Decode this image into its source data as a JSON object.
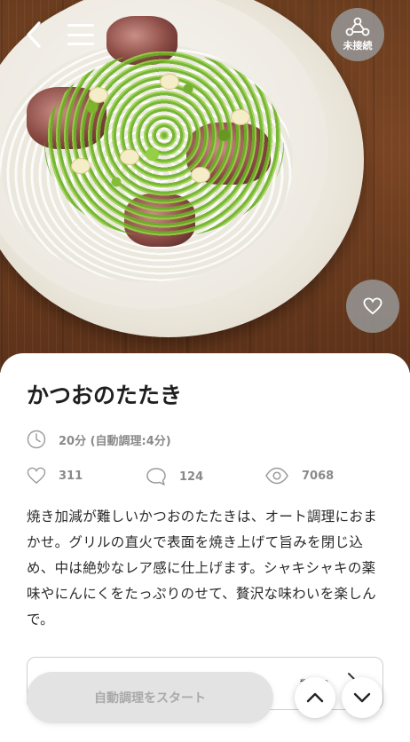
{
  "header": {
    "back_icon": "chevron-left-icon",
    "menu_icon": "hamburger-menu-icon",
    "connection_status": "未接続",
    "connection_icon": "network-nodes-icon",
    "favorite_icon": "heart-icon"
  },
  "recipe": {
    "title": "かつおのたたき",
    "time": "20分 (自動調理:4分)",
    "likes": "311",
    "comments": "124",
    "views": "7068",
    "description": "焼き加減が難しいかつおのたたきは、オート調理におまかせ。グリルの直火で表面を焼き上げて旨みを閉じ込め、中は絶妙なレア感に仕上げます。シャキシャキの薬味やにんにくをたっぷりのせて、贅沢な味わいを楽しんで。"
  },
  "servings": {
    "label_partial": "数 12"
  },
  "actions": {
    "start_label": "自動調理をスタート",
    "scroll_up_icon": "chevron-up-icon",
    "scroll_down_icon": "chevron-down-icon"
  },
  "colors": {
    "badge_bg": "#969696",
    "muted_text": "#8a8a8a",
    "button_disabled_bg": "#e3e3e3",
    "button_disabled_text": "#a9a9a9"
  }
}
